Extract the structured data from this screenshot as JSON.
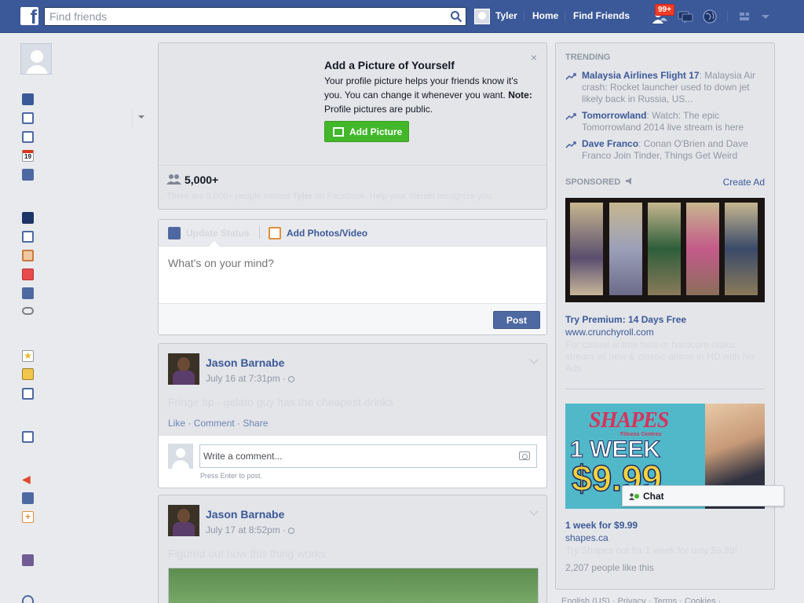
{
  "header": {
    "search_placeholder": "Find friends",
    "user_name": "Tyler",
    "home_label": "Home",
    "find_friends_label": "Find Friends",
    "friend_requests_badge": "99+"
  },
  "profile_prompt": {
    "title": "Add a Picture of Yourself",
    "body": "Your profile picture helps your friends know it's you. You can change it whenever you want.",
    "note_label": "Note:",
    "note_text": " Profile pictures are public.",
    "button_label": "Add Picture",
    "close_symbol": "×",
    "people_count": "5,000+",
    "people_note_prefix": "There are 5,000+ people named ",
    "people_note_name": "Tyler",
    "people_note_suffix": " on Facebook. Help your friends recognize you."
  },
  "composer": {
    "tab_status": "Update Status",
    "tab_photo": "Add Photos/Video",
    "placeholder": "What's on your mind?",
    "post_label": "Post"
  },
  "stories": [
    {
      "author": "Jason Barnabe",
      "time": "July 16 at 7:31pm · ",
      "text": "Fringe tip - gelato guy has the cheapest drinks",
      "like": "Like",
      "comment": "Comment",
      "share": "Share",
      "comment_placeholder": "Write a comment...",
      "comment_hint": "Press Enter to post."
    },
    {
      "author": "Jason Barnabe",
      "time": "July 17 at 8:52pm · ",
      "text": "Figured out how this thing works"
    }
  ],
  "sidebar": {
    "trending_header": "TRENDING",
    "trending": [
      {
        "topic": "Malaysia Airlines Flight 17",
        "desc": ": Malaysia Air crash: Rocket launcher used to down jet likely back in Russia, US..."
      },
      {
        "topic": "Tomorrowland",
        "desc": ": Watch: The epic Tomorrowland 2014 live stream is here"
      },
      {
        "topic": "Dave Franco",
        "desc": ": Conan O'Brien and Dave Franco Join Tinder, Things Get Weird"
      }
    ],
    "sponsored_header": "SPONSORED",
    "create_ad": "Create Ad",
    "ads": [
      {
        "title": "Try Premium: 14 Days Free",
        "url": "www.crunchyroll.com",
        "desc": "For casual anime fans or hardcore otaku, stream all new & classic anime in HD with No Ads."
      },
      {
        "logo": "SHAPES",
        "logo_sub": "Fitness Centres",
        "headline": "1 WEEK",
        "price": "$9.99",
        "title": "1 week for $9.99",
        "url": "shapes.ca",
        "desc": "Try Shapes out for 1 week for only $9.99!",
        "likes": "2,207 people like this"
      }
    ],
    "footer": "English (US) · Privacy · Terms · Cookies ·"
  },
  "chat": {
    "label": "Chat"
  },
  "colors": {
    "brand": "#3b5998",
    "accent_green": "#42b72a",
    "badge_red": "#f03d25"
  }
}
